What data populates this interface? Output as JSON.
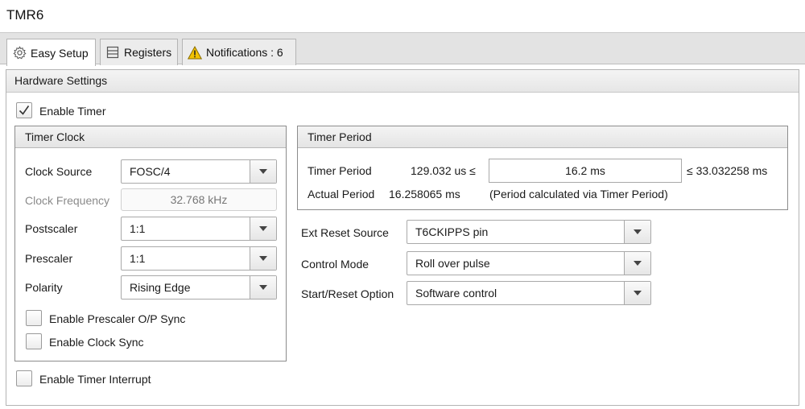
{
  "window": {
    "title": "TMR6"
  },
  "tabs": [
    {
      "label": "Easy Setup",
      "icon": "gear-icon"
    },
    {
      "label": "Registers",
      "icon": "list-icon"
    },
    {
      "label": "Notifications : 6",
      "icon": "warning-icon"
    }
  ],
  "hardware_settings": {
    "header": "Hardware Settings",
    "enable_timer": {
      "label": "Enable Timer",
      "checked": true
    },
    "enable_timer_interrupt": {
      "label": "Enable Timer Interrupt",
      "checked": false
    }
  },
  "timer_clock": {
    "header": "Timer Clock",
    "clock_source": {
      "label": "Clock Source",
      "value": "FOSC/4"
    },
    "clock_frequency": {
      "label": "Clock Frequency",
      "value": "32.768 kHz"
    },
    "postscaler": {
      "label": "Postscaler",
      "value": "1:1"
    },
    "prescaler": {
      "label": "Prescaler",
      "value": "1:1"
    },
    "polarity": {
      "label": "Polarity",
      "value": "Rising Edge"
    },
    "enable_prescaler_sync": {
      "label": "Enable Prescaler O/P Sync",
      "checked": false
    },
    "enable_clock_sync": {
      "label": "Enable Clock Sync",
      "checked": false
    }
  },
  "timer_period": {
    "header": "Timer Period",
    "label": "Timer Period",
    "min": "129.032 us ≤",
    "value": "16.2 ms",
    "max": "≤ 33.032258 ms",
    "actual_label": "Actual Period",
    "actual_value": "16.258065 ms",
    "note": "(Period calculated via Timer Period)"
  },
  "reset": {
    "ext_reset_source": {
      "label": "Ext Reset Source",
      "value": "T6CKIPPS pin"
    },
    "control_mode": {
      "label": "Control Mode",
      "value": "Roll over pulse"
    },
    "start_reset_option": {
      "label": "Start/Reset Option",
      "value": "Software control"
    }
  },
  "colors": {
    "warning": "#f2c200",
    "border": "#8c8c8c",
    "header_bg": "#e6e6e6"
  }
}
